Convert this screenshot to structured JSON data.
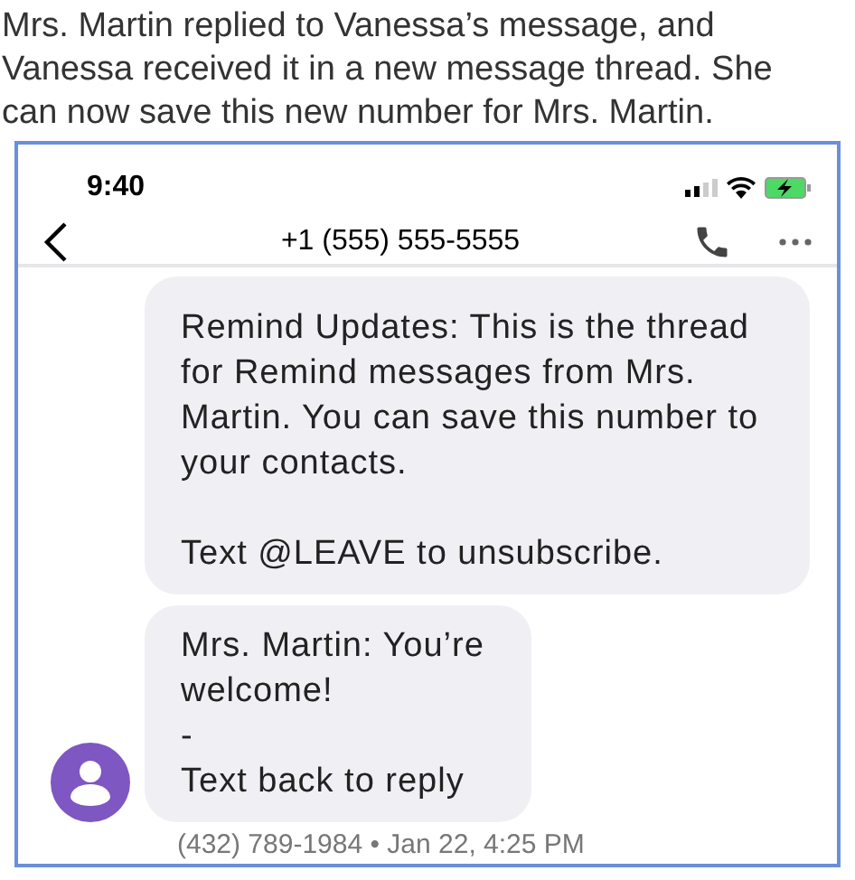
{
  "caption": "Mrs. Martin replied to Vanessa’s message, and Vanessa received it in a new message thread. She can now save this new number for Mrs. Martin.",
  "status_bar": {
    "time": "9:40"
  },
  "header": {
    "title": "+1 (555) 555-5555"
  },
  "messages": [
    {
      "text": "Remind Updates: This is the thread for Remind messages from Mrs. Martin. You can save this number to your contacts.\n\nText @LEAVE to unsubscribe.",
      "avatar": false
    },
    {
      "text": "Mrs. Martin: You’re welcome!\n-\nText back to reply",
      "avatar": true
    }
  ],
  "meta": "(432) 789-1984 • Jan 22, 4:25 PM"
}
